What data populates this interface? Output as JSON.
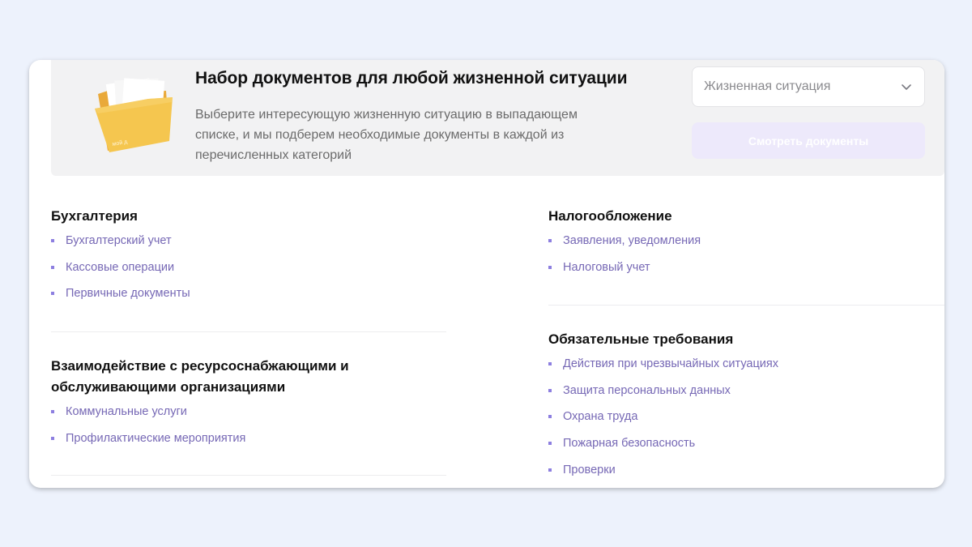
{
  "hero": {
    "title": "Набор документов для любой жизненной ситуации",
    "description": "Выберите интересующую жизненную ситуацию в выпадающем списке, и мы подберем необходимые документы в каждой из перечисленных категорий",
    "select_placeholder": "Жизненная ситуация",
    "button_label": "Смотреть документы",
    "folder_label": "мой д"
  },
  "sections": {
    "accounting": {
      "title": "Бухгалтерия",
      "items": [
        "Бухгалтерский учет",
        "Кассовые операции",
        "Первичные документы"
      ]
    },
    "utilities": {
      "title": "Взаимодействие с ресурсоснабжающими и обслуживающими организациями",
      "items": [
        "Коммунальные услуги",
        "Профилактические мероприятия"
      ]
    },
    "taxes": {
      "title": "Налогообложение",
      "items": [
        "Заявления, уведомления",
        "Налоговый учет"
      ]
    },
    "requirements": {
      "title": "Обязательные требования",
      "items": [
        "Действия при чрезвычайных ситуациях",
        "Защита персональных данных",
        "Охрана труда",
        "Пожарная безопасность",
        "Проверки"
      ]
    }
  },
  "colors": {
    "page_bg": "#edf2fc",
    "link": "#7668b5",
    "bullet": "#8d7fe0",
    "button_bg": "#ede9fb",
    "folder": "#f5c64f"
  }
}
